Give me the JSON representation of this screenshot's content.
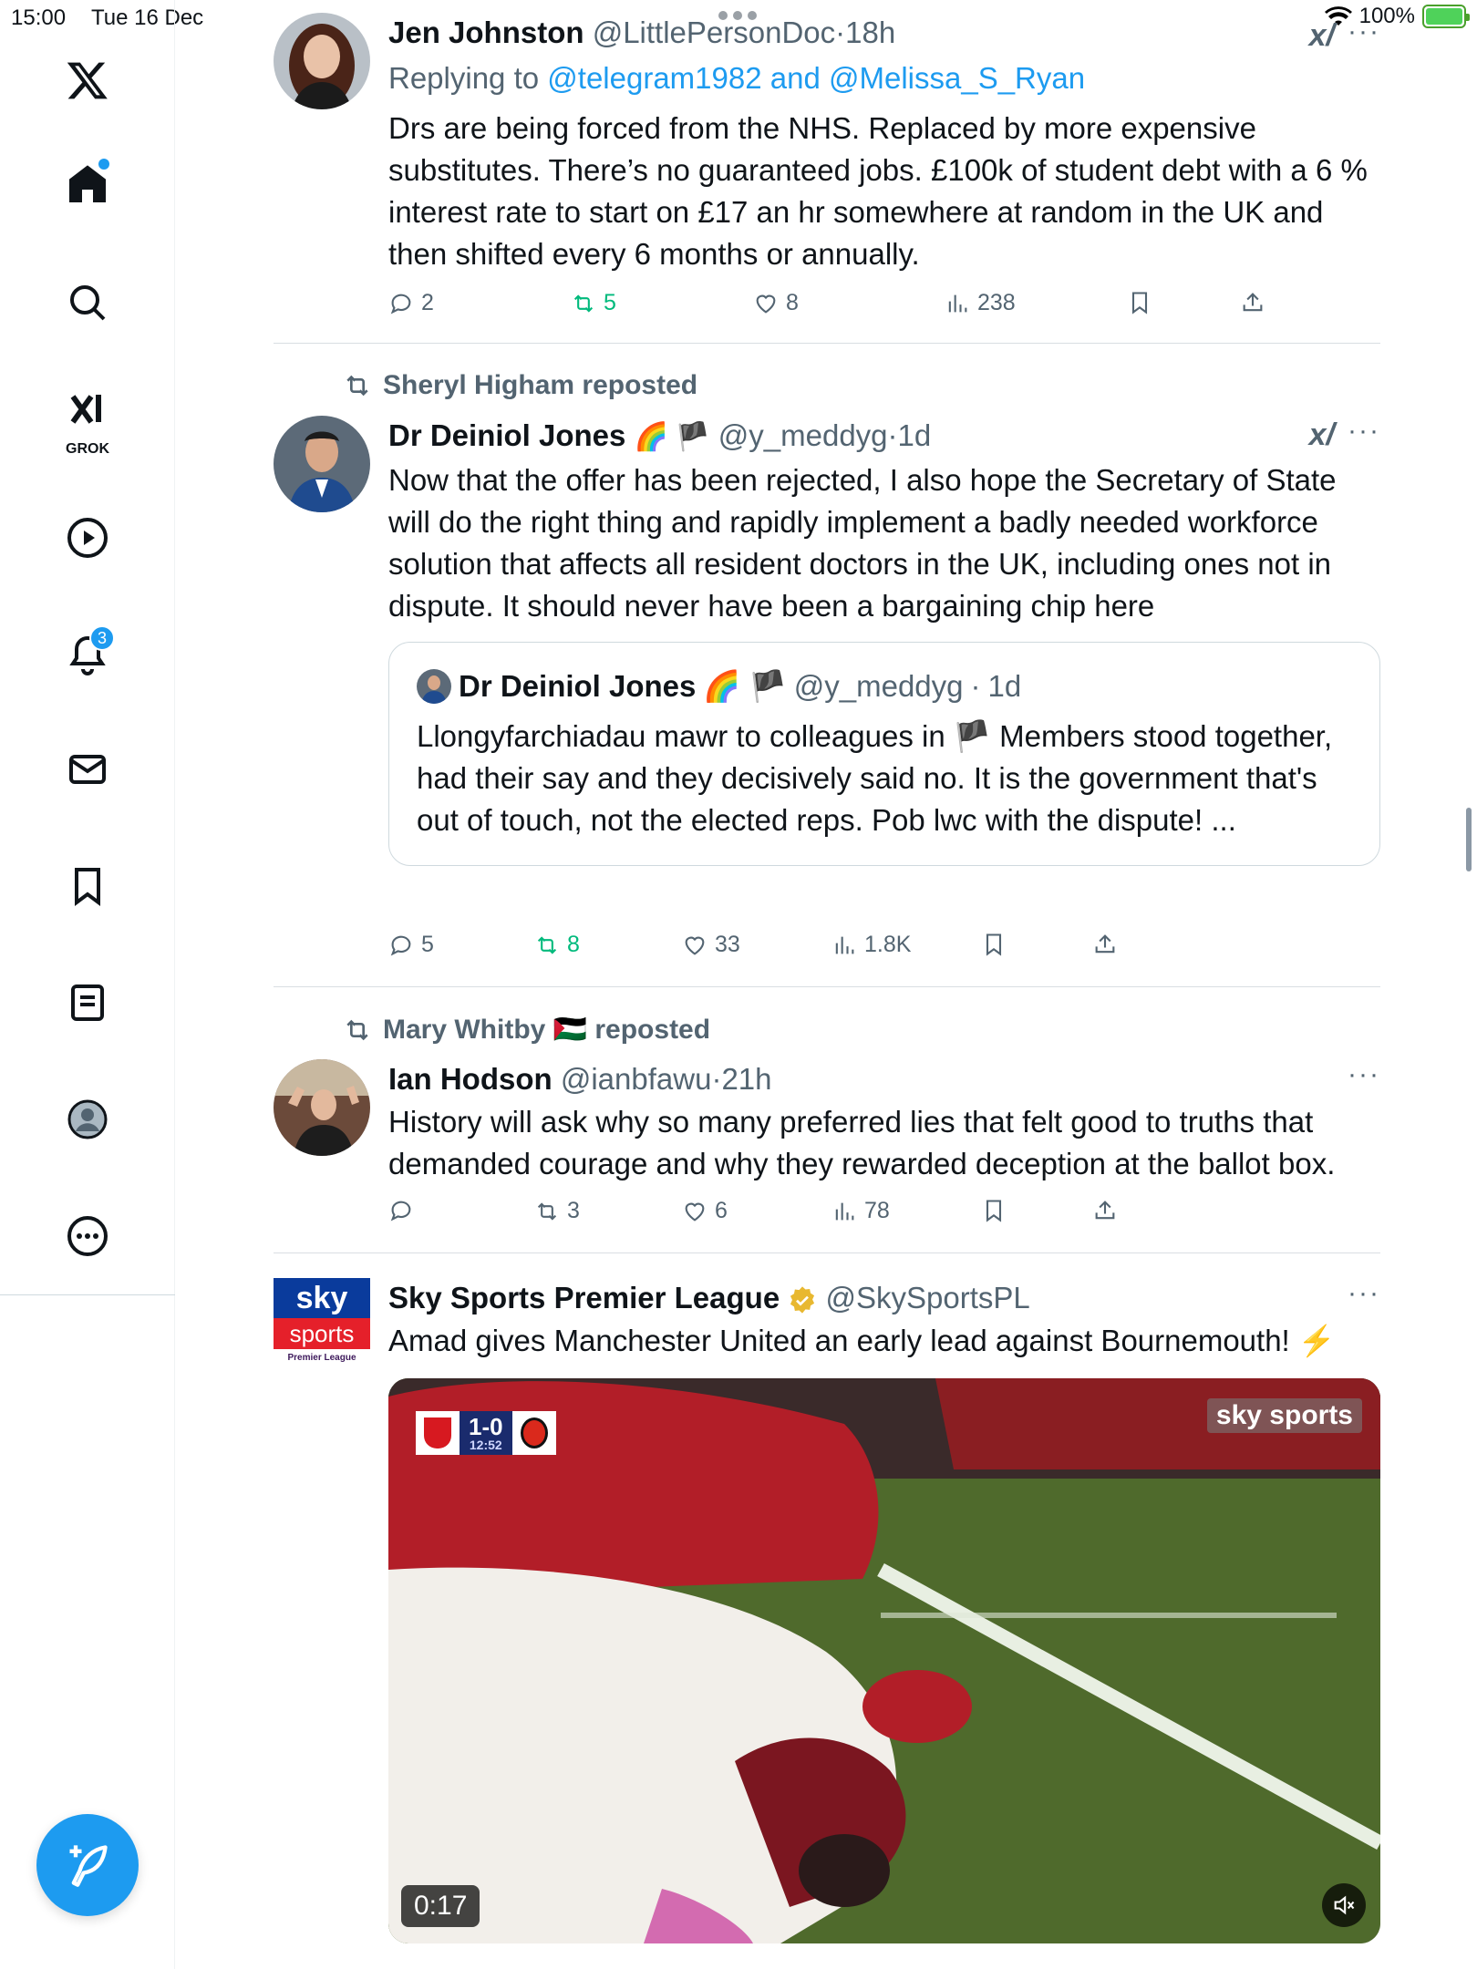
{
  "status_bar": {
    "time": "15:00",
    "date": "Tue 16 Dec",
    "battery": "100%"
  },
  "sidebar": {
    "items": [
      {
        "name": "x-logo"
      },
      {
        "name": "home",
        "has_dot": true
      },
      {
        "name": "search"
      },
      {
        "name": "grok",
        "label": "GROK"
      },
      {
        "name": "video"
      },
      {
        "name": "notifications",
        "badge": "3"
      },
      {
        "name": "messages"
      },
      {
        "name": "bookmarks"
      },
      {
        "name": "lists"
      },
      {
        "name": "profile"
      },
      {
        "name": "more"
      }
    ]
  },
  "posts": [
    {
      "name": "Jen Johnston",
      "handle": "@LittlePersonDoc",
      "time": "18h",
      "replying_prefix": "Replying to",
      "replying_to": "@telegram1982 and @Melissa_S_Ryan",
      "body": "Drs are being forced from the NHS. Replaced by more expensive substitutes. There’s no guaranteed jobs. £100k of student debt with a 6 % interest rate to start on £17 an hr somewhere at random in the UK and then shifted every 6 months or annually.",
      "replies": "2",
      "reposts": "5",
      "likes": "8",
      "views": "238"
    },
    {
      "reposted_by": "Sheryl Higham reposted",
      "name": "Dr Deiniol Jones",
      "emoji": "🌈 🏴",
      "handle": "@y_meddyg",
      "time": "1d",
      "body": "Now that the offer has been rejected, I also hope the Secretary of State will do the right thing and rapidly implement a badly needed workforce solution that affects all resident doctors in the UK, including ones not in dispute. It should never have been a bargaining chip here",
      "quote": {
        "name": "Dr Deiniol Jones",
        "emoji": "🌈 🏴",
        "handle": "@y_meddyg",
        "time": "1d",
        "body": "Llongyfarchiadau mawr to colleagues in 🏴 Members stood together, had their say and they decisively said no. It is the government that's out of touch, not the elected reps. Pob lwc with the dispute! ..."
      },
      "replies": "5",
      "reposts": "8",
      "likes": "33",
      "views": "1.8K"
    },
    {
      "reposted_by": "Mary Whitby 🇵🇸 reposted",
      "name": "Ian Hodson",
      "handle": "@ianbfawu",
      "time": "21h",
      "body": "History will ask why so many preferred lies that felt good to truths that demanded courage and why they rewarded deception at the ballot box.",
      "replies": "",
      "reposts": "3",
      "likes": "6",
      "views": "78"
    },
    {
      "name": "Sky Sports Premier League",
      "handle": "@SkySportsPL",
      "body": "Amad gives Manchester United an early lead against Bournemouth! ⚡",
      "avatar_text_1": "sky",
      "avatar_text_2": "sports",
      "avatar_text_3": "Premier League",
      "video": {
        "duration": "0:17",
        "score": "1-0",
        "clock": "12:52",
        "watermark": "sky sports"
      }
    }
  ],
  "icons": {
    "reply": "speech-bubble-icon",
    "repost": "repost-arrows-icon",
    "like": "heart-icon",
    "views": "bar-chart-icon",
    "bookmark": "bookmark-icon",
    "share": "share-upload-icon",
    "more": "ellipsis-icon",
    "compose": "feather-plus-icon"
  },
  "colors": {
    "accent": "#1d9bf0",
    "repost_green": "#00ba7c",
    "secondary_text": "#536471"
  }
}
